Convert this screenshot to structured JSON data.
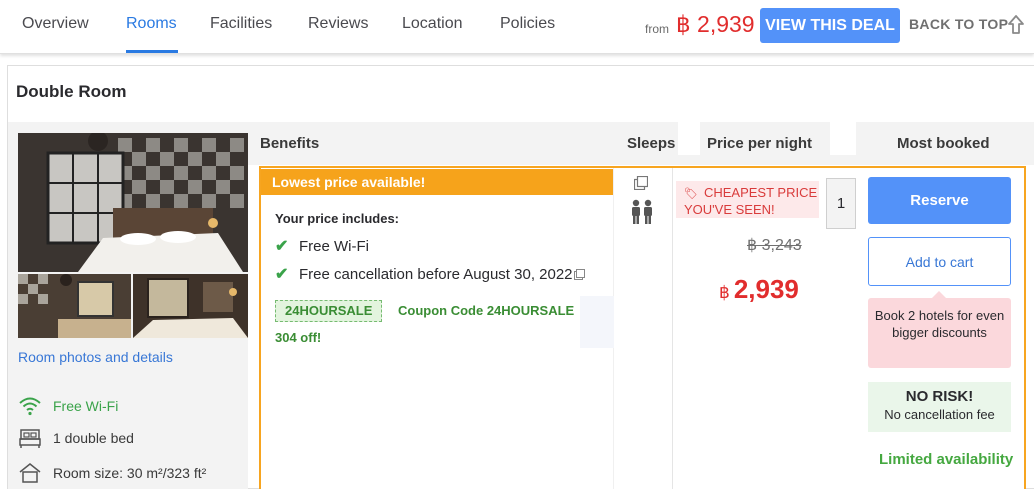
{
  "nav": {
    "tabs": [
      {
        "label": "Overview"
      },
      {
        "label": "Rooms"
      },
      {
        "label": "Facilities"
      },
      {
        "label": "Reviews"
      },
      {
        "label": "Location"
      },
      {
        "label": "Policies"
      }
    ],
    "active_tab": "Rooms",
    "from_label": "from",
    "price": "฿ 2,939",
    "deal_button": "VIEW THIS DEAL",
    "back_to_top": "BACK TO TOP"
  },
  "room": {
    "title": "Double Room",
    "photos_link": "Room photos and details",
    "features": [
      {
        "icon": "wifi-icon",
        "label": "Free Wi-Fi"
      },
      {
        "icon": "bed-icon",
        "label": "1 double bed"
      },
      {
        "icon": "house-icon",
        "label": "Room size: 30 m²/323 ft²"
      }
    ]
  },
  "table_headers": {
    "benefits": "Benefits",
    "sleeps": "Sleeps",
    "price_per_night": "Price per night",
    "most_booked": "Most booked"
  },
  "offer": {
    "banner": "Lowest price available!",
    "includes_label": "Your price includes:",
    "benefits": [
      "Free Wi-Fi",
      "Free cancellation before August 30, 2022"
    ],
    "coupon_code": "24HOURSALE",
    "coupon_text": "Coupon Code 24HOURSALE",
    "coupon_discount": "304 off!",
    "cheapest_line1": "CHEAPEST PRICE",
    "cheapest_line2": "YOU'VE SEEN!",
    "quantity": "1",
    "old_price": "฿ 3,243",
    "currency": "฿",
    "new_price": "2,939",
    "reserve_button": "Reserve",
    "cart_button": "Add to cart",
    "book_promo": "Book 2 hotels for even bigger discounts",
    "no_risk_title": "NO RISK!",
    "no_risk_sub": "No cancellation fee",
    "availability": "Limited availability"
  },
  "colors": {
    "accent_blue": "#5392f9",
    "price_red": "#e12d2d",
    "banner_orange": "#f6a31b",
    "success_green": "#3aa34a"
  }
}
